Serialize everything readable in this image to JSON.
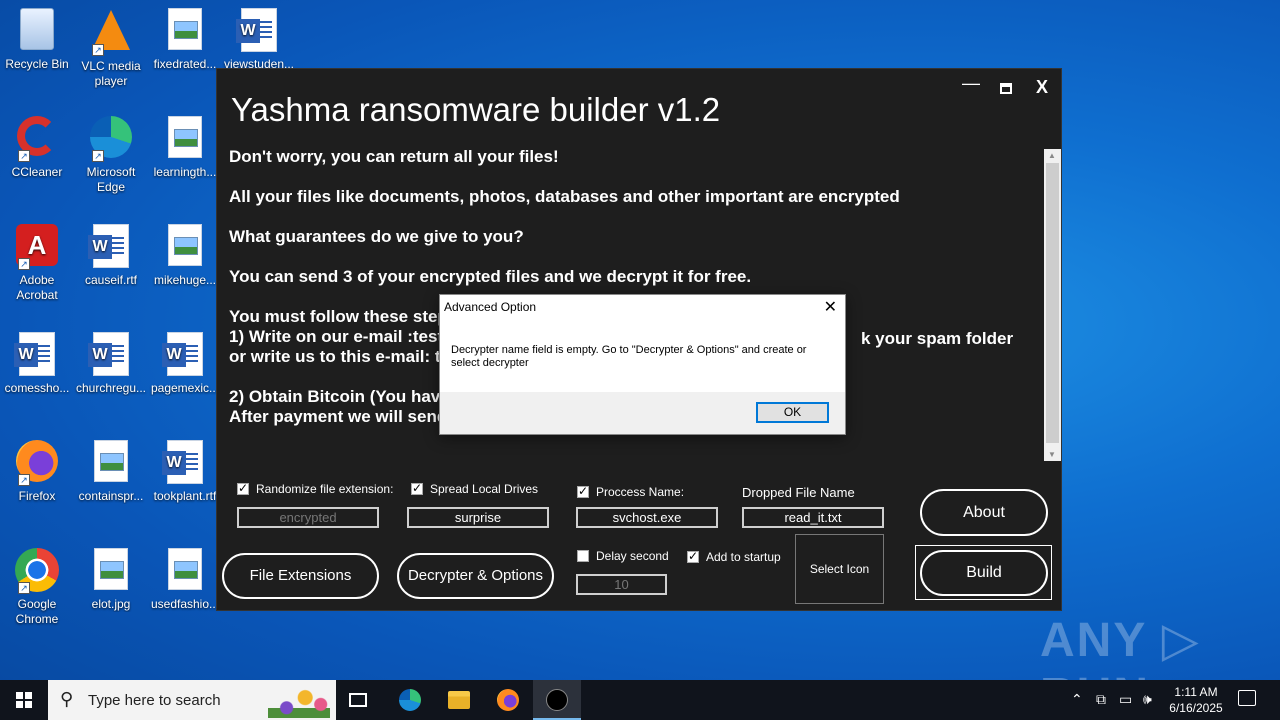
{
  "desktop": {
    "icons": [
      {
        "label": "Recycle Bin"
      },
      {
        "label": "VLC media player"
      },
      {
        "label": "fixedrated..."
      },
      {
        "label": "viewstuden..."
      },
      {
        "label": "CCleaner"
      },
      {
        "label": "Microsoft Edge"
      },
      {
        "label": "learningth..."
      },
      {
        "label": "Adobe Acrobat"
      },
      {
        "label": "causeif.rtf"
      },
      {
        "label": "mikehuge..."
      },
      {
        "label": "comessho..."
      },
      {
        "label": "churchregu..."
      },
      {
        "label": "pagemexic..."
      },
      {
        "label": "Firefox"
      },
      {
        "label": "containspr..."
      },
      {
        "label": "tookplant.rtf"
      },
      {
        "label": "Google Chrome"
      },
      {
        "label": "elot.jpg"
      },
      {
        "label": "usedfashio..."
      }
    ]
  },
  "builder": {
    "title": "Yashma ransomware builder v1.2",
    "window_controls": {
      "minimize": "—",
      "close": "X"
    },
    "note_lines": [
      "Don't worry, you can return all your files!",
      "All your files like documents, photos, databases and other important are encrypted",
      "What guarantees do we give to you?",
      "You can send 3 of your encrypted files and we decrypt it for free.",
      "You must follow these step",
      "1) Write on our e-mail :test",
      "or write us to this e-mail: te",
      "2) Obtain Bitcoin (You hav",
      "After payment we will send"
    ],
    "note_tail": "k your spam folder",
    "options": {
      "randomize_label": "Randomize file extension:",
      "randomize_value": "encrypted",
      "spread_label": "Spread Local Drives",
      "spread_value": "surprise",
      "process_label": "Proccess Name:",
      "process_value": "svchost.exe",
      "dropped_label": "Dropped File Name",
      "dropped_value": "read_it.txt",
      "delay_label": "Delay second",
      "delay_value": "10",
      "startup_label": "Add to startup"
    },
    "buttons": {
      "file_extensions": "File Extensions",
      "decrypter_options": "Decrypter & Options",
      "select_icon": "Select Icon",
      "about": "About",
      "build": "Build"
    }
  },
  "dialog": {
    "title": "Advanced Option",
    "message": "Decrypter name field is empty. Go to \"Decrypter & Options\" and create or select decrypter",
    "ok": "OK",
    "close": "✕"
  },
  "watermark": "ANY ▷ RUN",
  "taskbar": {
    "search_placeholder": "Type here to search",
    "time": "1:11 AM",
    "date": "6/16/2025"
  },
  "icons": {
    "search": "search-icon",
    "windows": "windows-logo-icon"
  }
}
